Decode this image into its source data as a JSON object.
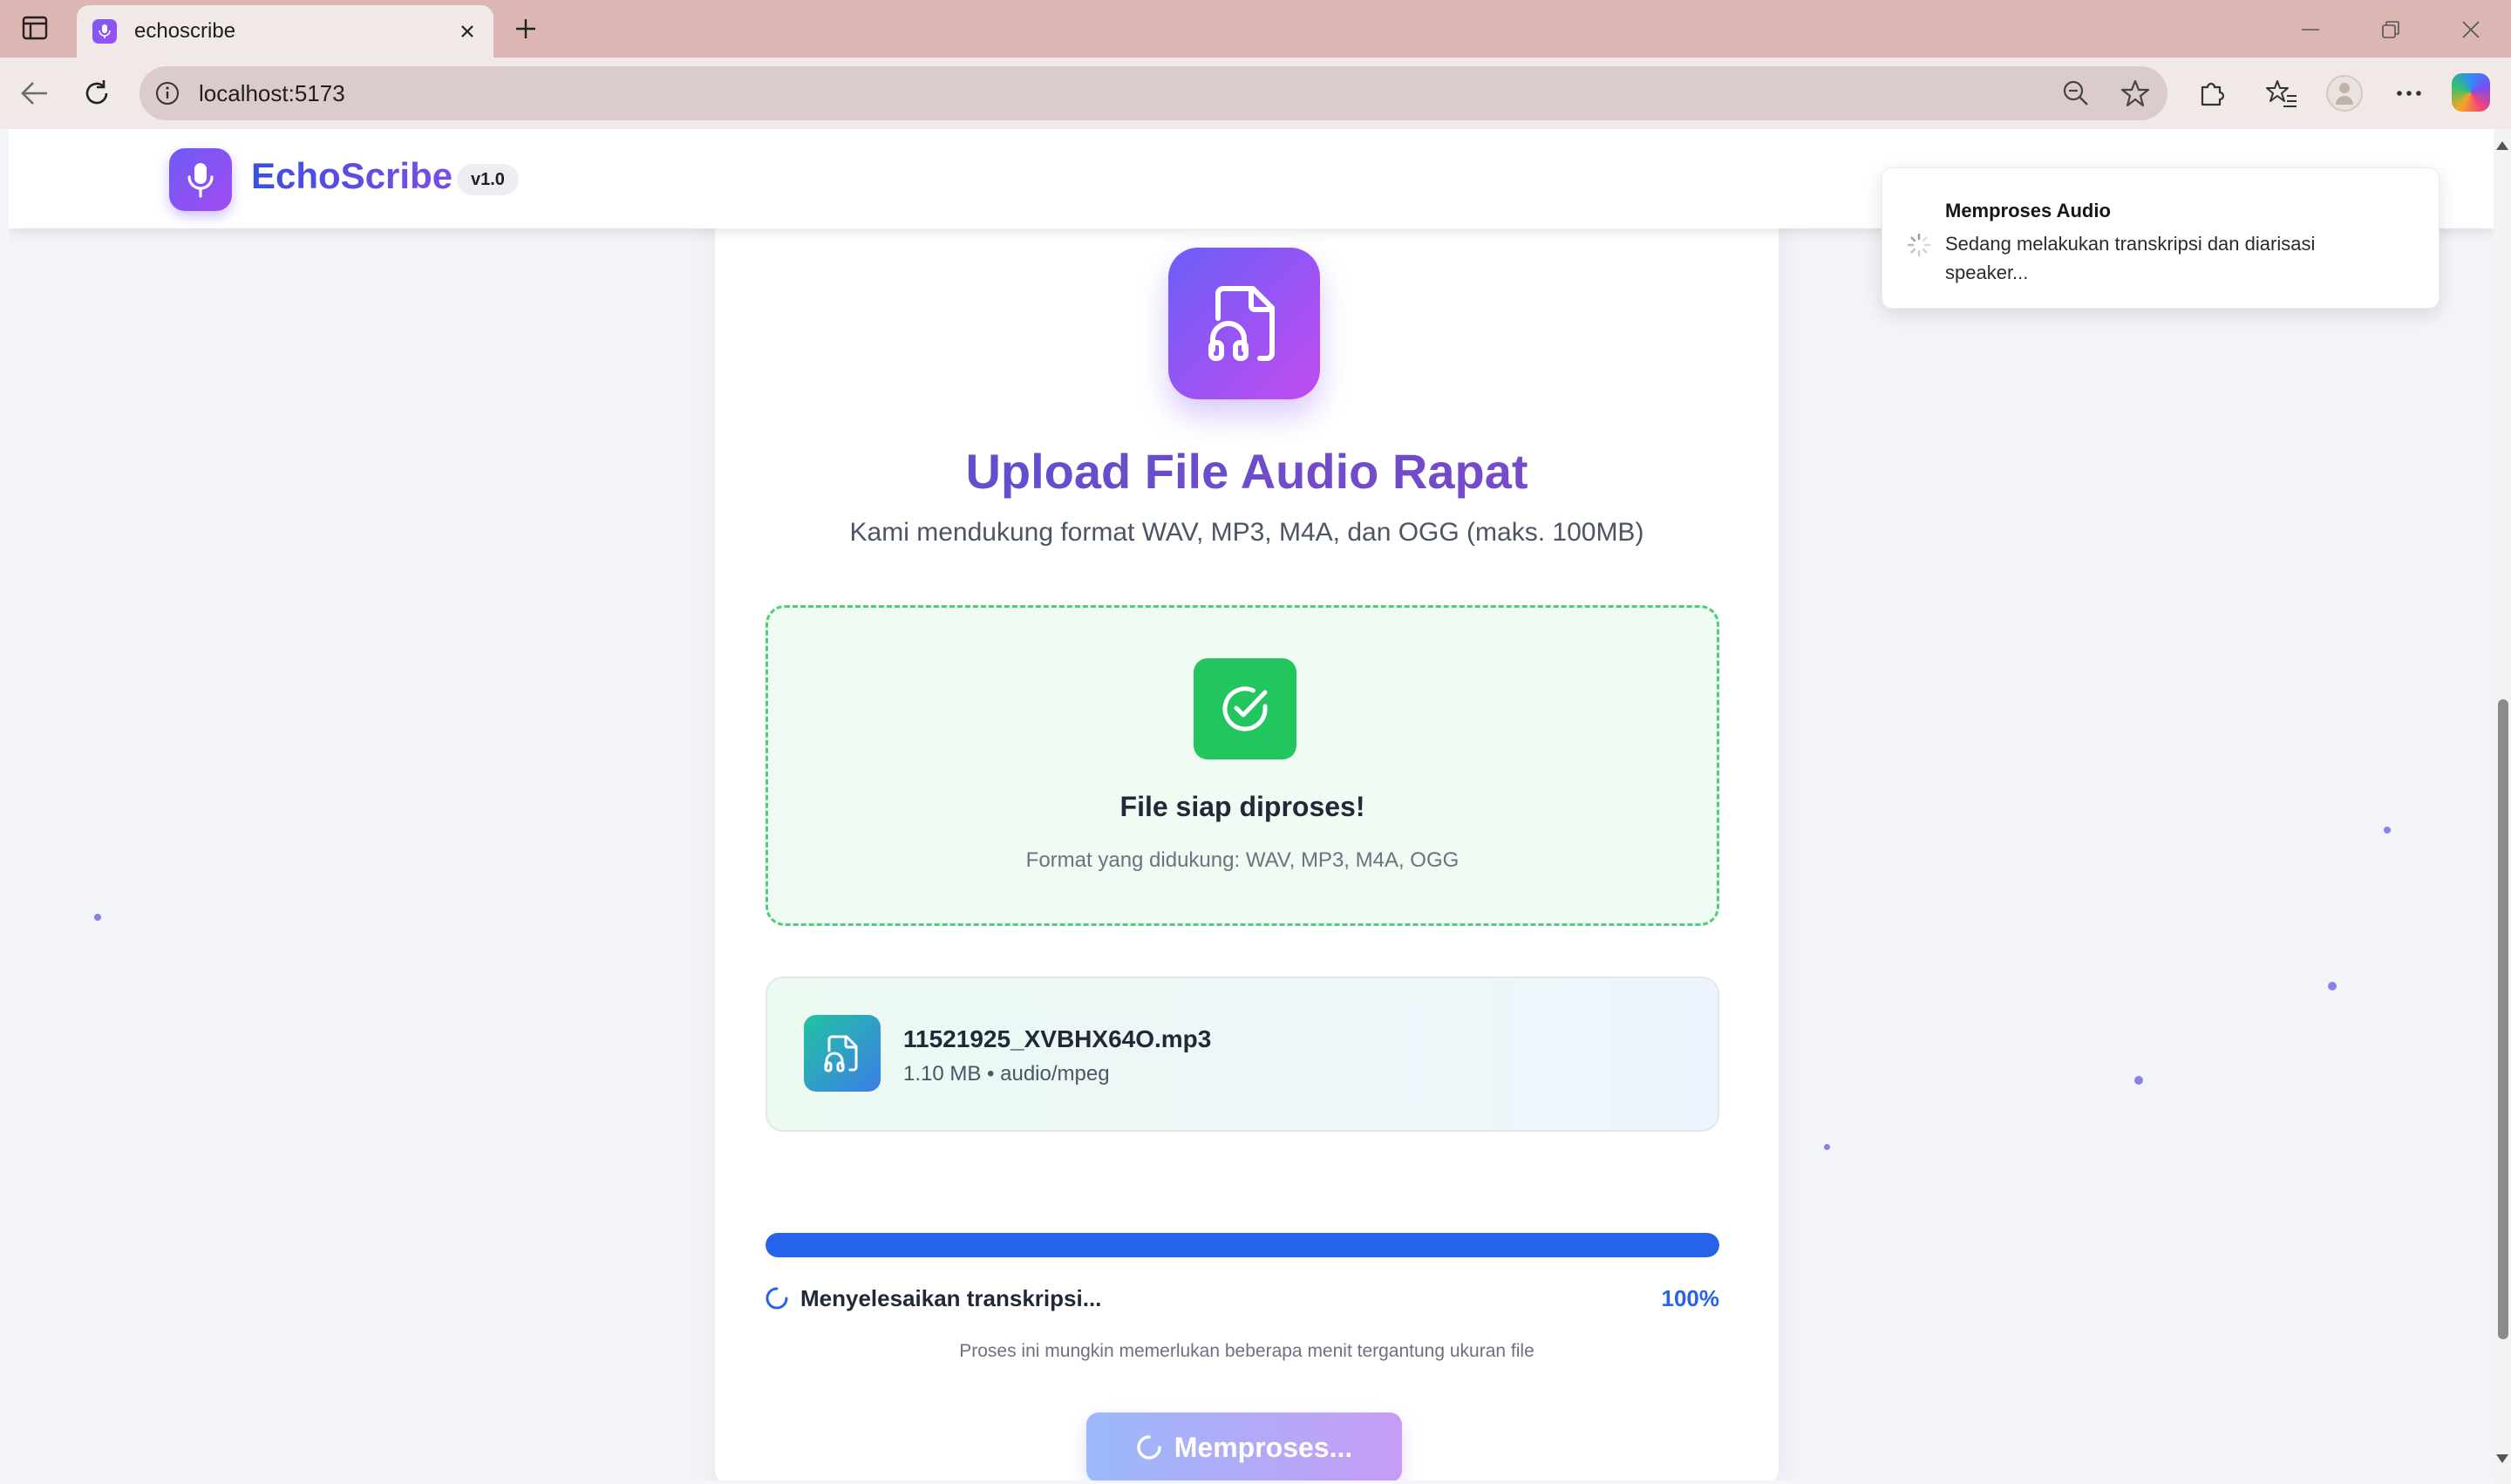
{
  "browser": {
    "tab_title": "echoscribe",
    "url": "localhost:5173"
  },
  "app": {
    "brand": "EchoScribe",
    "version": "v1.0"
  },
  "toast": {
    "title": "Memproses Audio",
    "description": "Sedang melakukan transkripsi dan diarisasi speaker..."
  },
  "upload": {
    "title": "Upload File Audio Rapat",
    "subtitle": "Kami mendukung format WAV, MP3, M4A, dan OGG (maks. 100MB)",
    "dropzone_title": "File siap diproses!",
    "dropzone_note": "Format yang didukung: WAV, MP3, M4A, OGG"
  },
  "file": {
    "name": "11521925_XVBHX64O.mp3",
    "meta": "1.10 MB • audio/mpeg"
  },
  "progress": {
    "value": 1.0,
    "status_text": "Menyelesaikan transkripsi...",
    "percent_label": "100%",
    "note": "Proses ini mungkin memerlukan beberapa menit tergantung ukuran file"
  },
  "action": {
    "button_label": "Memproses..."
  },
  "colors": {
    "accent_blue": "#2563eb",
    "success_green": "#22c55e",
    "brand_purple": "#7e4be8"
  }
}
